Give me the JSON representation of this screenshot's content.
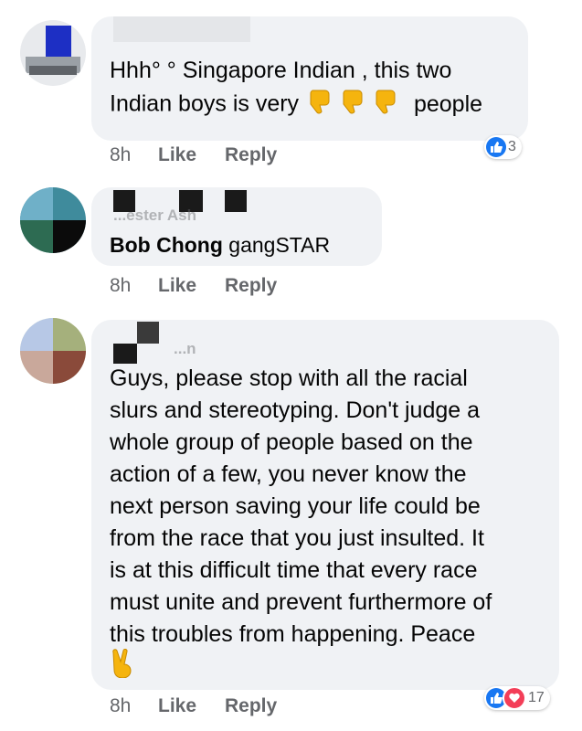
{
  "comments": [
    {
      "author": "",
      "text_lines": [
        "Hhh° ° Singapore Indian , this two",
        "Indian boys is very"
      ],
      "text_tail": "people",
      "emoji_count": 3,
      "emoji": "thumbs-down-emoji",
      "time": "8h",
      "like_label": "Like",
      "reply_label": "Reply",
      "reaction_count": "3",
      "reactions": [
        "like"
      ]
    },
    {
      "author_partial": "...ester Ash",
      "mention": "Bob Chong",
      "text": "gangSTAR",
      "time": "8h",
      "like_label": "Like",
      "reply_label": "Reply"
    },
    {
      "author_partial": "...n",
      "text_lines": [
        "Guys, please stop with all the racial",
        "slurs and stereotyping. Don't judge a",
        "whole group of people based on the",
        "action of a few, you never know the",
        "next person saving your life could be",
        "from the race that you just insulted. It",
        "is at this difficult time that every race",
        "must unite and prevent furthermore of",
        "this troubles from happening. Peace"
      ],
      "emoji": "victory-hand-emoji",
      "time": "8h",
      "like_label": "Like",
      "reply_label": "Reply",
      "reaction_count": "17",
      "reactions": [
        "like",
        "love"
      ]
    }
  ],
  "colors": {
    "bubble": "#f0f2f5",
    "meta_text": "#65676b",
    "like_blue": "#1877f2",
    "love_red": "#f33e58"
  }
}
